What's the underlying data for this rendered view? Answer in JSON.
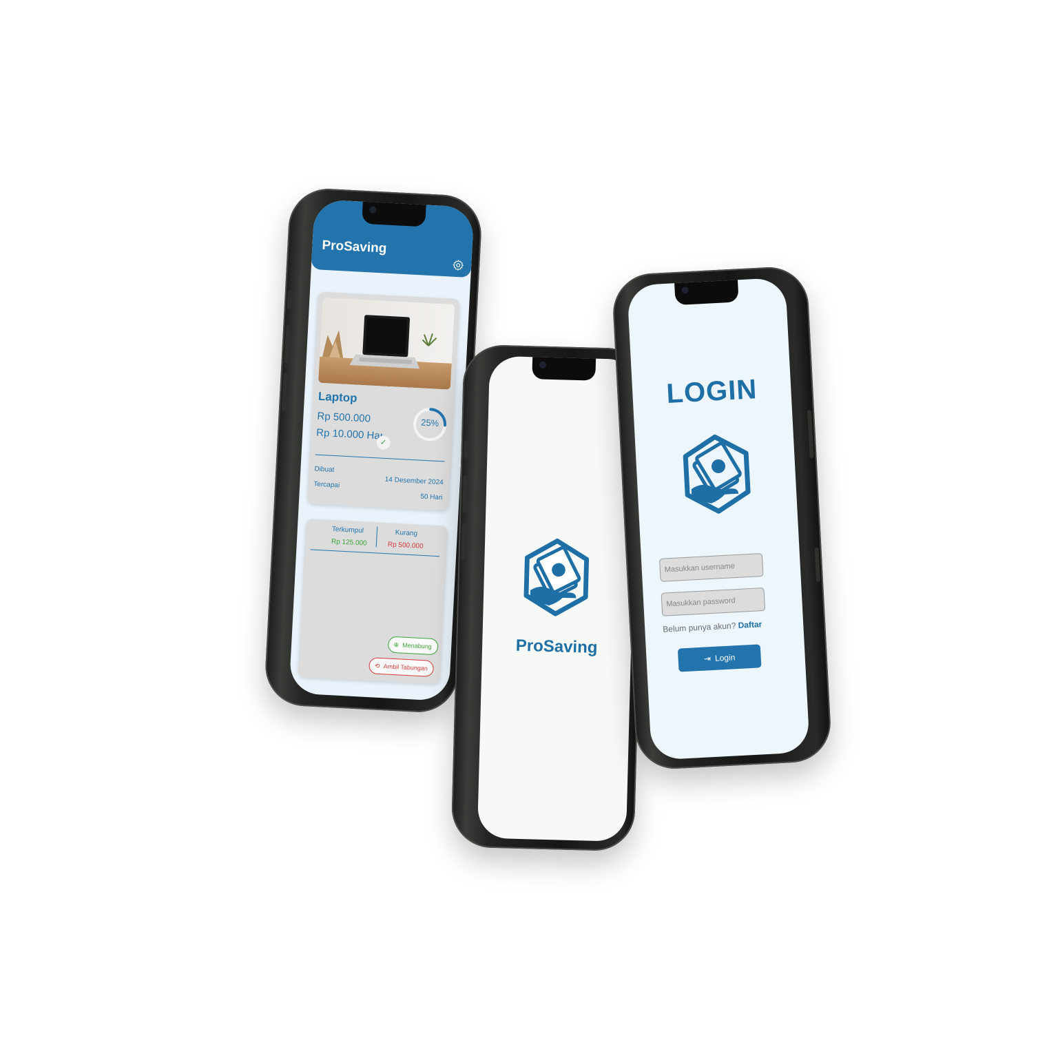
{
  "app": {
    "name": "ProSaving",
    "primary_color": "#2374ad",
    "splash_bg": "#f6f9f6",
    "login_bg": "#edf5fd"
  },
  "dashboard": {
    "title": "ProSaving",
    "settings_icon": "gear-icon",
    "goal": {
      "name": "Laptop",
      "image": "laptop-on-desk-photo",
      "target_amount": "Rp 500.000",
      "daily_amount": "Rp 10.000 Hari",
      "progress_label": "25%",
      "progress_fraction": 0.25,
      "created_label": "Dibuat",
      "created_value": "14 Desember 2024",
      "reached_label": "Tercapai",
      "reached_value": "50 Hari"
    },
    "summary": {
      "collected_label": "Terkumpul",
      "collected_value": "Rp 125.000",
      "collected_color": "#3aa53a",
      "remaining_label": "Kurang",
      "remaining_value": "Rp 500.000",
      "remaining_color": "#d83a3a"
    },
    "actions": {
      "save_label": "Menabung",
      "save_color": "#3aa53a",
      "withdraw_label": "Ambil Tabungan",
      "withdraw_color": "#d83a3a"
    }
  },
  "splash": {
    "title": "ProSaving",
    "logo_icon": "money-hand-hexagon-icon"
  },
  "login": {
    "title": "LOGIN",
    "logo_icon": "money-hand-hexagon-icon",
    "username_placeholder": "Masukkan username",
    "password_placeholder": "Masukkan password",
    "register_prompt": "Belum punya akun?",
    "register_link": "Daftar",
    "login_button": "Login",
    "login_icon": "login-arrow-icon"
  }
}
